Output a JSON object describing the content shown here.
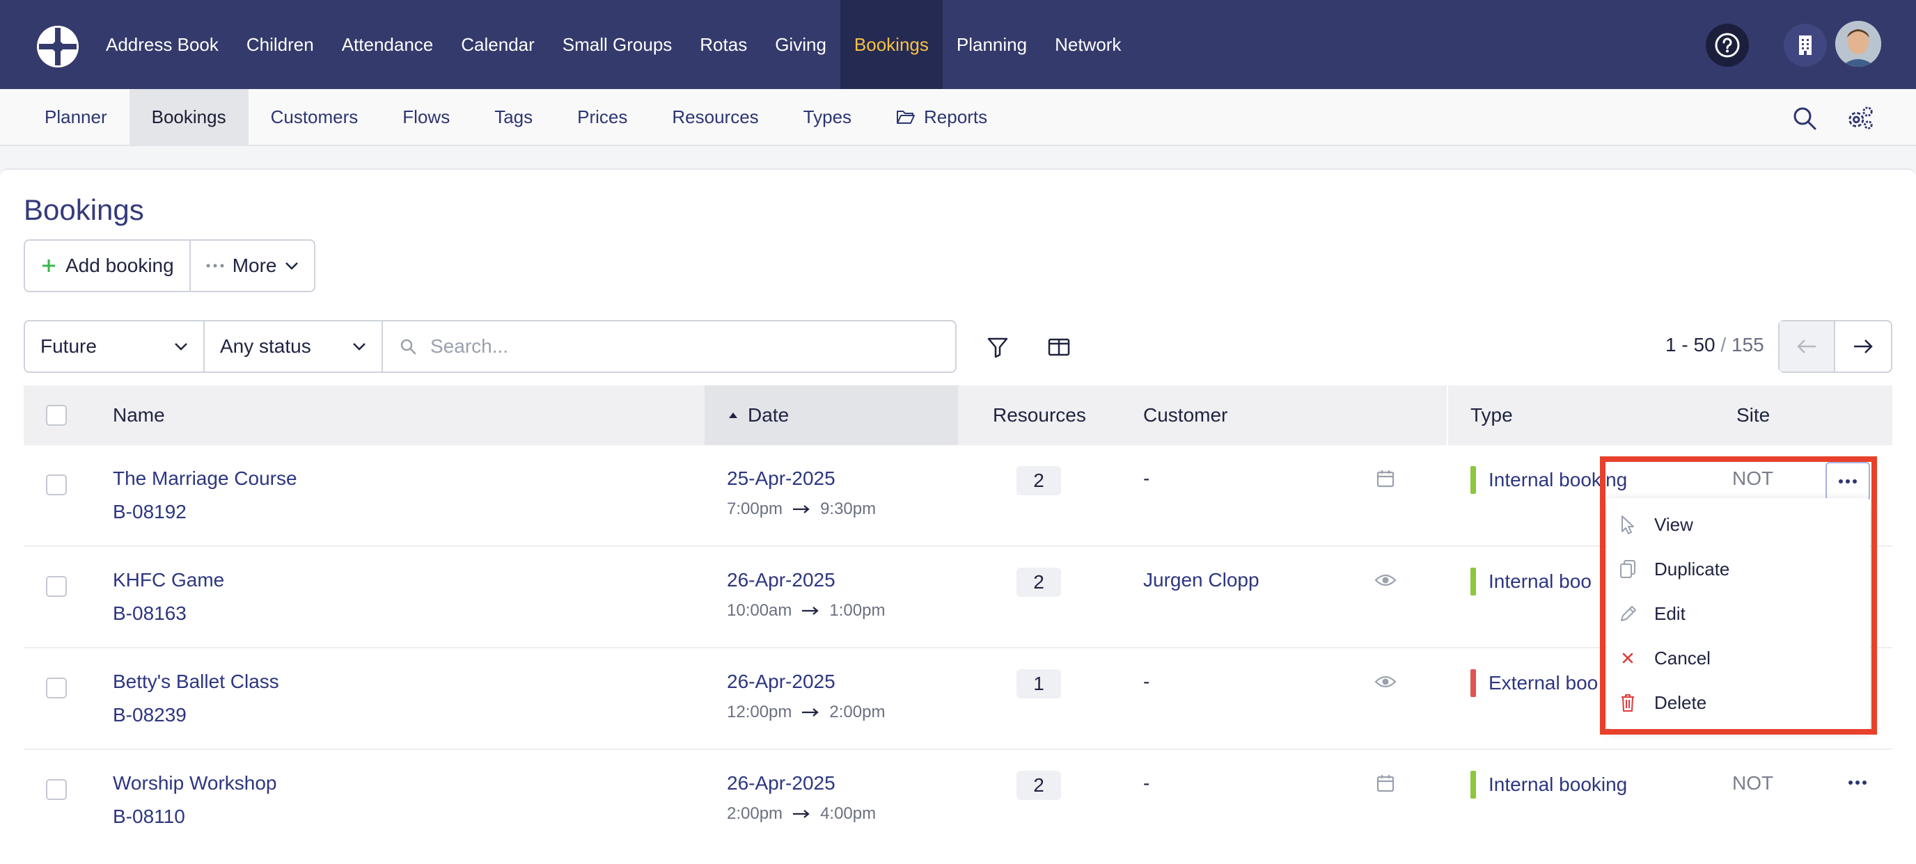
{
  "topnav": {
    "items": [
      "Address Book",
      "Children",
      "Attendance",
      "Calendar",
      "Small Groups",
      "Rotas",
      "Giving",
      "Bookings",
      "Planning",
      "Network"
    ],
    "active": "Bookings",
    "icons": [
      "help-icon",
      "building-icon",
      "avatar"
    ]
  },
  "subnav": {
    "items": [
      "Planner",
      "Bookings",
      "Customers",
      "Flows",
      "Tags",
      "Prices",
      "Resources",
      "Types",
      "Reports"
    ],
    "active": "Bookings",
    "icons": [
      "search-icon",
      "settings-icon"
    ]
  },
  "page": {
    "title": "Bookings",
    "add_label": "Add booking",
    "more_label": "More"
  },
  "filters": {
    "when": "Future",
    "status": "Any status",
    "search_placeholder": "Search..."
  },
  "pager": {
    "range": "1 - 50",
    "separator": " / ",
    "total": "155"
  },
  "table": {
    "headers": {
      "name": "Name",
      "date": "Date",
      "resources": "Resources",
      "customer": "Customer",
      "type": "Type",
      "site": "Site"
    },
    "rows": [
      {
        "name": "The Marriage Course",
        "ref": "B-08192",
        "date": "25-Apr-2025",
        "start": "7:00pm",
        "end": "9:30pm",
        "resources": "2",
        "customer": "-",
        "customer_icon": "calendar-icon",
        "type": "Internal booking",
        "type_color": "#8dc63f",
        "site": "NOT"
      },
      {
        "name": "KHFC Game",
        "ref": "B-08163",
        "date": "26-Apr-2025",
        "start": "10:00am",
        "end": "1:00pm",
        "resources": "2",
        "customer": "Jurgen Clopp",
        "customer_icon": "eye-icon",
        "type": "Internal boo",
        "type_color": "#8dc63f",
        "site": ""
      },
      {
        "name": "Betty's Ballet Class",
        "ref": "B-08239",
        "date": "26-Apr-2025",
        "start": "12:00pm",
        "end": "2:00pm",
        "resources": "1",
        "customer": "-",
        "customer_icon": "eye-icon",
        "type": "External boo",
        "type_color": "#e05454",
        "site": ""
      },
      {
        "name": "Worship Workshop",
        "ref": "B-08110",
        "date": "26-Apr-2025",
        "start": "2:00pm",
        "end": "4:00pm",
        "resources": "2",
        "customer": "-",
        "customer_icon": "calendar-icon",
        "type": "Internal booking",
        "type_color": "#8dc63f",
        "site": "NOT"
      }
    ]
  },
  "dropdown": {
    "items": [
      {
        "label": "View",
        "icon": "cursor-icon"
      },
      {
        "label": "Duplicate",
        "icon": "copy-icon"
      },
      {
        "label": "Edit",
        "icon": "pencil-icon"
      },
      {
        "label": "Cancel",
        "icon": "x-icon"
      },
      {
        "label": "Delete",
        "icon": "trash-icon"
      }
    ]
  },
  "colors": {
    "nav_bg": "#343a6b",
    "nav_active_bg": "#252a52",
    "nav_active_text": "#f5c243",
    "link": "#2d3680",
    "internal": "#8dc63f",
    "external": "#e05454",
    "highlight": "#e8402a",
    "danger": "#e03a3a"
  }
}
